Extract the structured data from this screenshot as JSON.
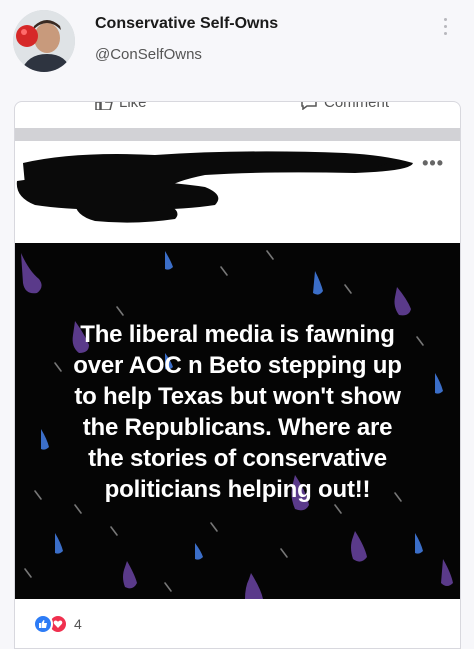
{
  "account": {
    "display_name": "Conservative Self-Owns",
    "handle": "@ConSelfOwns"
  },
  "post": {
    "actions": {
      "like_label": "Like",
      "comment_label": "Comment"
    },
    "author_redacted": true,
    "meme": {
      "lines": [
        "The liberal media is fawning",
        "over AOC n Beto stepping up",
        "to help Texas but won't show",
        "the Republicans. Where are",
        "the stories of conservative",
        "politicians helping out!!"
      ]
    },
    "reactions": {
      "types": [
        "like-icon",
        "love-icon"
      ],
      "count": "4"
    }
  },
  "colors": {
    "like": "#2d7cf6",
    "love": "#f0304f",
    "meme_background": "#050505"
  }
}
